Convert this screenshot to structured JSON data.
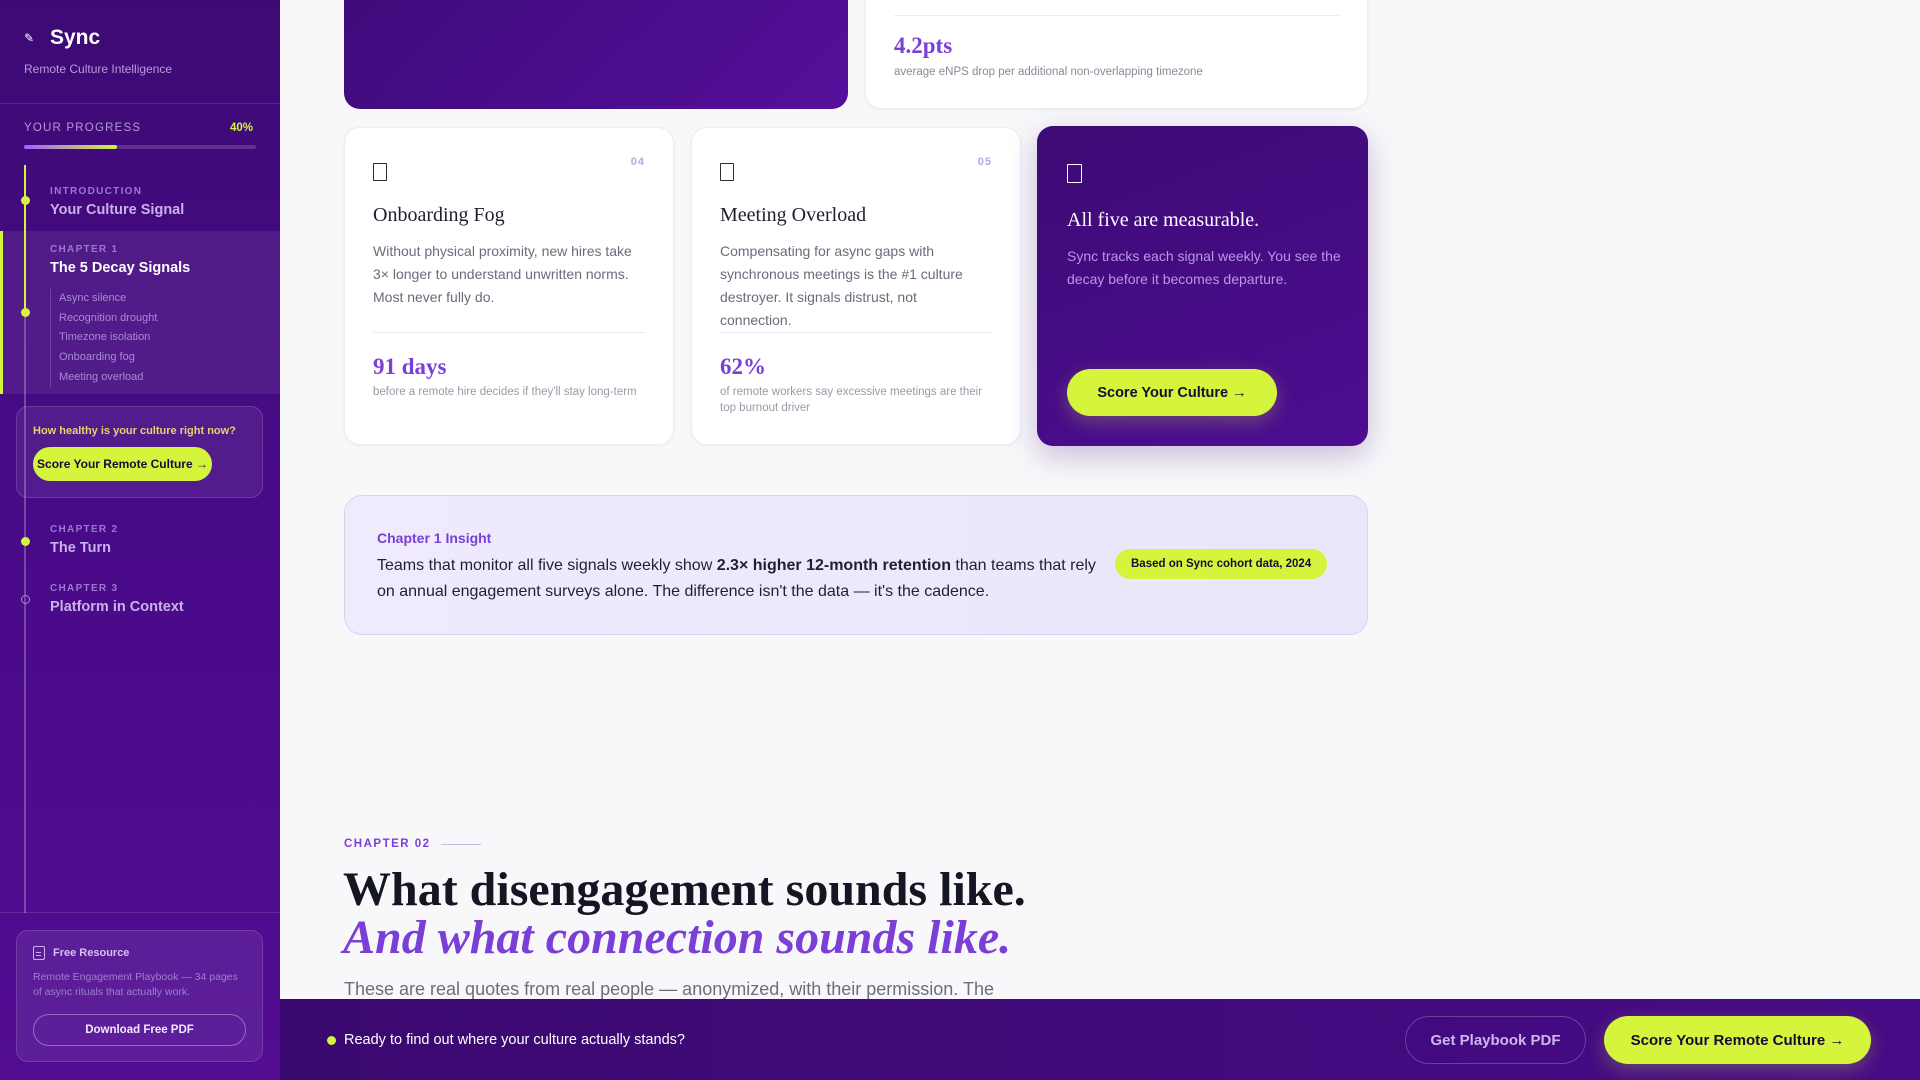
{
  "brand": {
    "name": "Sync",
    "tagline": "Remote Culture Intelligence",
    "logo_icon": "pen-nib-icon"
  },
  "progress": {
    "label": "YOUR PROGRESS",
    "value_text": "40%",
    "value": 0.4
  },
  "toc": {
    "intro": {
      "eyebrow": "INTRODUCTION",
      "title": "Your Culture Signal"
    },
    "chapter1": {
      "eyebrow": "CHAPTER 1",
      "title": "The 5 Decay Signals",
      "subitems": [
        "Async silence",
        "Recognition drought",
        "Timezone isolation",
        "Onboarding fog",
        "Meeting overload"
      ]
    },
    "chapter2": {
      "eyebrow": "CHAPTER 2",
      "title": "The Turn"
    },
    "chapter3": {
      "eyebrow": "CHAPTER 3",
      "title": "Platform in Context"
    }
  },
  "sidebar_cta": {
    "question": "How healthy is your culture right now?",
    "button": "Score Your Remote Culture →"
  },
  "resource": {
    "title": "Free Resource",
    "description": "Remote Engagement Playbook — 34 pages of async rituals that actually work.",
    "button": "Download Free PDF"
  },
  "top_card": {
    "stat": "4.2pts",
    "stat_desc": "average eNPS drop per additional non-overlapping timezone"
  },
  "cards": [
    {
      "number": "04",
      "title": "Onboarding Fog",
      "body": "Without physical proximity, new hires take 3× longer to understand unwritten norms. Most never fully do.",
      "stat": "91 days",
      "stat_desc": "before a remote hire decides if they'll stay long-term"
    },
    {
      "number": "05",
      "title": "Meeting Overload",
      "body": "Compensating for async gaps with synchronous meetings is the #1 culture destroyer. It signals distrust, not connection.",
      "stat": "62%",
      "stat_desc": "of remote workers say excessive meetings are their top burnout driver"
    }
  ],
  "dark_card": {
    "title": "All five are measurable.",
    "body": "Sync tracks each signal weekly. You see the decay before it becomes departure.",
    "button": "Score Your Culture →"
  },
  "insight": {
    "label": "Chapter 1 Insight",
    "text_before": "Teams that monitor all five signals weekly show ",
    "text_bold": "2.3× higher 12-month retention",
    "text_after": " than teams that rely on annual engagement surveys alone. The difference isn't the data — it's the cadence.",
    "badge": "Based on Sync cohort data, 2024"
  },
  "chapter2": {
    "eyebrow": "CHAPTER 02",
    "heading_line1": "What disengagement sounds like.",
    "heading_line2": "And what connection sounds like.",
    "lede": "These are real quotes from real people — anonymized, with their permission. The"
  },
  "bottom_bar": {
    "text": "Ready to find out where your culture actually stands?",
    "secondary_button": "Get Playbook PDF",
    "primary_button": "Score Your Remote Culture →"
  },
  "colors": {
    "accent_lime": "#d4f53b",
    "brand_purple": "#4a0a8a",
    "stat_purple": "#7a3fd6"
  }
}
